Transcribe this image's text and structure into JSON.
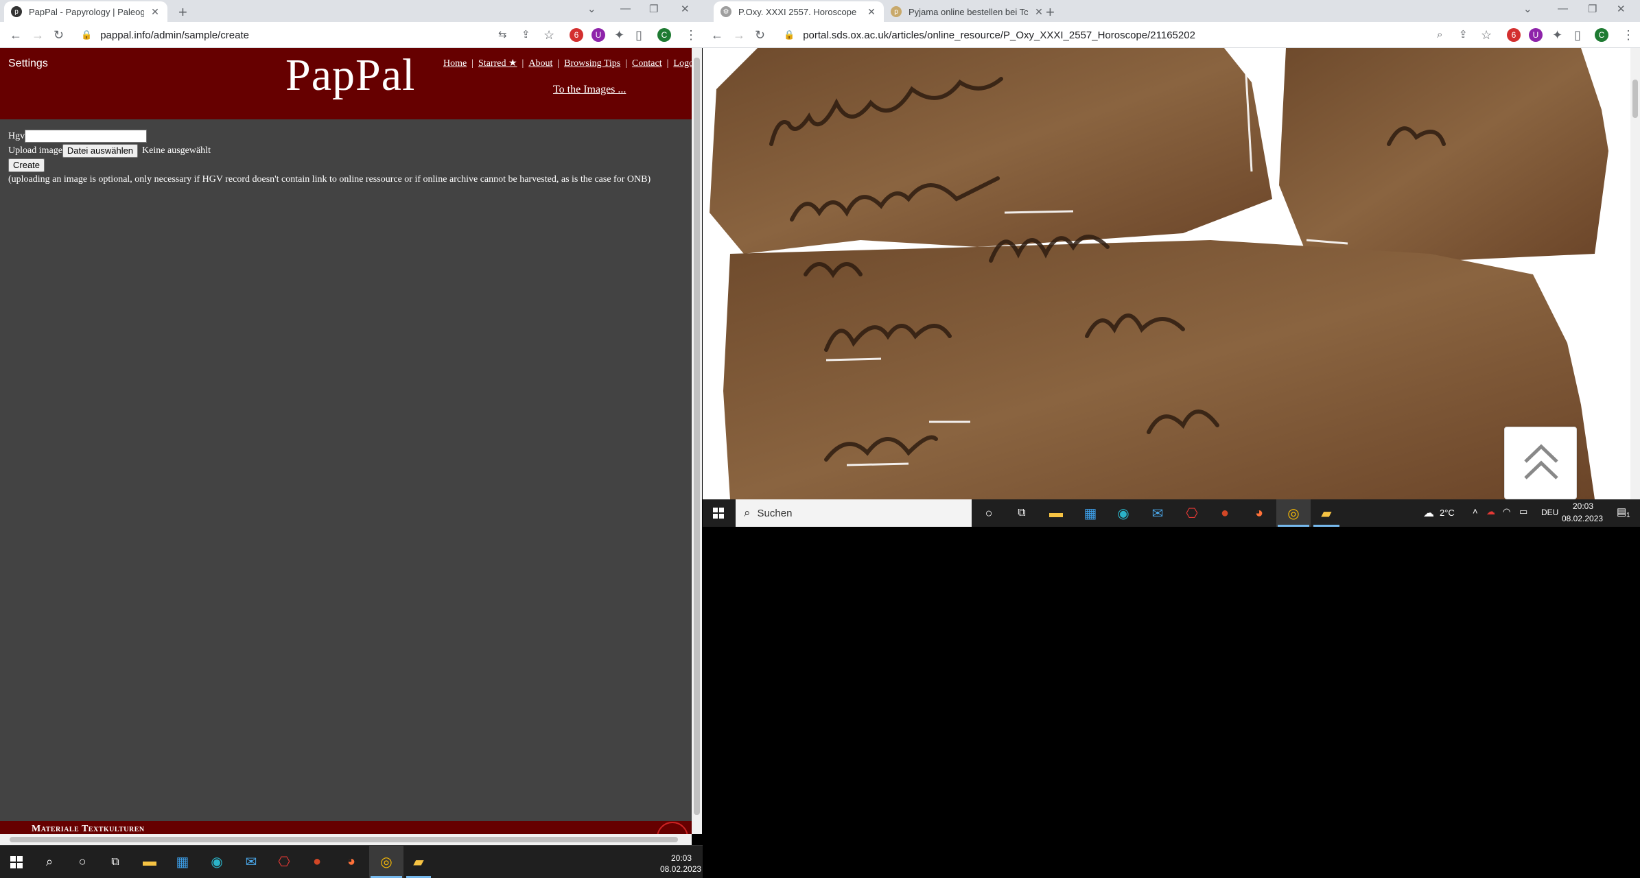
{
  "left_window": {
    "tab": {
      "title": "PapPal - Papyrology | Paleograph",
      "favicon": "pappal-favicon"
    },
    "url": "pappal.info/admin/sample/create",
    "profile_initial": "C",
    "page": {
      "settings_label": "Settings",
      "logo": "PapPal",
      "nav": {
        "home": "Home",
        "starred": "Starred ★",
        "about": "About",
        "browsing_tips": "Browsing Tips",
        "contact": "Contact",
        "logout": "Logou"
      },
      "to_images": "To the Images ...",
      "form": {
        "hgv_label": "Hgv",
        "hgv_value": "",
        "upload_label": "Upload image",
        "choose_file_button": "Datei auswählen",
        "no_file_text": "Keine ausgewählt",
        "create_button": "Create",
        "note": "(uploading an image is optional, only necessary if HGV record doesn't contain link to online ressource or if online archive cannot be harvested, as is the case for ONB)"
      },
      "footer_text": "Materiale Textkulturen"
    }
  },
  "right_window": {
    "tabs": [
      {
        "title": "P.Oxy. XXXI 2557. Horoscope",
        "active": true
      },
      {
        "title": "Pyjama online bestellen bei Tchib",
        "active": false
      }
    ],
    "url": "portal.sds.ox.ac.uk/articles/online_resource/P_Oxy_XXXI_2557_Horoscope/21165202",
    "profile_initial": "C"
  },
  "taskbar_left": {
    "clock_time": "20:03",
    "clock_date": "08.02.2023"
  },
  "taskbar_right": {
    "search_placeholder": "Suchen",
    "weather": "2°C",
    "language": "DEU",
    "clock_time": "20:03",
    "clock_date": "08.02.2023",
    "notification_count": "1"
  },
  "colors": {
    "pappal_red": "#660000",
    "page_grey": "#434343",
    "papyrus": "#7a5535",
    "taskbar": "#1f1f1f"
  }
}
